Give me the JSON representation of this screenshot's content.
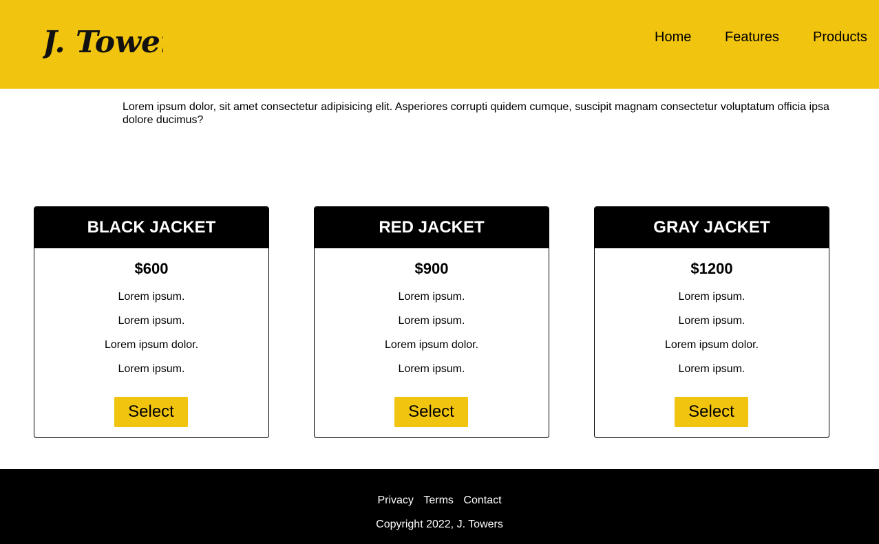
{
  "brand": {
    "logo_text": "J. Towers",
    "color": "#f1c40f"
  },
  "nav": {
    "items": [
      {
        "label": "Home"
      },
      {
        "label": "Features"
      },
      {
        "label": "Products"
      }
    ]
  },
  "intro": {
    "text": "Lorem ipsum dolor, sit amet consectetur adipisicing elit. Asperiores corrupti quidem cumque, suscipit magnam consectetur voluptatum officia ipsa dolore ducimus?"
  },
  "products": [
    {
      "name": "BLACK JACKET",
      "price": "$600",
      "features": [
        "Lorem ipsum.",
        "Lorem ipsum.",
        "Lorem ipsum dolor.",
        "Lorem ipsum."
      ],
      "button": "Select"
    },
    {
      "name": "RED JACKET",
      "price": "$900",
      "features": [
        "Lorem ipsum.",
        "Lorem ipsum.",
        "Lorem ipsum dolor.",
        "Lorem ipsum."
      ],
      "button": "Select"
    },
    {
      "name": "GRAY JACKET",
      "price": "$1200",
      "features": [
        "Lorem ipsum.",
        "Lorem ipsum.",
        "Lorem ipsum dolor.",
        "Lorem ipsum."
      ],
      "button": "Select"
    }
  ],
  "footer": {
    "links": [
      {
        "label": "Privacy"
      },
      {
        "label": "Terms"
      },
      {
        "label": "Contact"
      }
    ],
    "copyright": "Copyright 2022, J. Towers"
  }
}
